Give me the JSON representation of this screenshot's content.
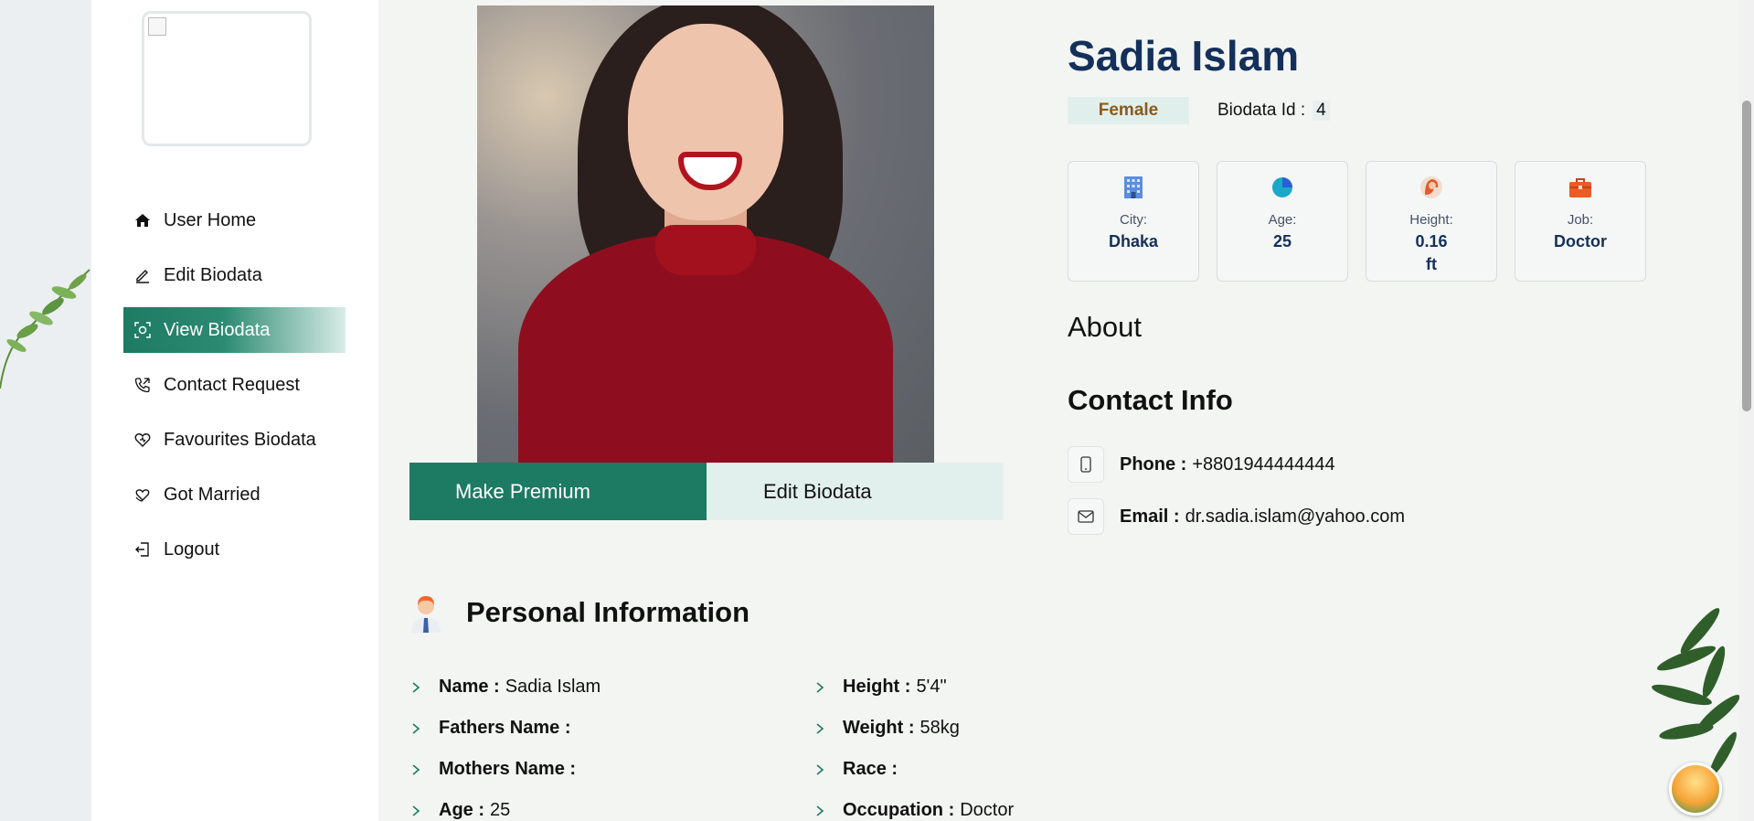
{
  "sidebar": {
    "items": [
      {
        "label": "User Home",
        "icon": "home-icon"
      },
      {
        "label": "Edit Biodata",
        "icon": "pencil-icon"
      },
      {
        "label": "View Biodata",
        "icon": "scan-icon"
      },
      {
        "label": "Contact Request",
        "icon": "phone-icon"
      },
      {
        "label": "Favourites Biodata",
        "icon": "heart-icon"
      },
      {
        "label": "Got Married",
        "icon": "heart-hands-icon"
      },
      {
        "label": "Logout",
        "icon": "logout-icon"
      }
    ],
    "active_index": 2
  },
  "actions": {
    "premium_label": "Make Premium",
    "edit_label": "Edit Biodata"
  },
  "profile": {
    "name": "Sadia Islam",
    "gender": "Female",
    "biodata_id_label": "Biodata Id :",
    "biodata_id": "4",
    "cards": [
      {
        "label": "City:",
        "value": "Dhaka",
        "icon": "city-icon"
      },
      {
        "label": "Age:",
        "value": "25",
        "icon": "pie-icon"
      },
      {
        "label": "Height:",
        "value": "0.16",
        "value2": "ft",
        "icon": "height-icon"
      },
      {
        "label": "Job:",
        "value": "Doctor",
        "icon": "briefcase-icon"
      }
    ]
  },
  "about": {
    "heading": "About"
  },
  "contact": {
    "heading": "Contact Info",
    "phone_label": "Phone :",
    "phone": "+8801944444444",
    "email_label": "Email :",
    "email": "dr.sadia.islam@yahoo.com"
  },
  "personal": {
    "heading": "Personal Information",
    "left": [
      {
        "label": "Name :",
        "value": "Sadia Islam"
      },
      {
        "label": "Fathers Name :",
        "value": ""
      },
      {
        "label": "Mothers Name :",
        "value": ""
      },
      {
        "label": "Age :",
        "value": "25"
      }
    ],
    "right": [
      {
        "label": "Height :",
        "value": "5'4\""
      },
      {
        "label": "Weight :",
        "value": "58kg"
      },
      {
        "label": "Race :",
        "value": ""
      },
      {
        "label": "Occupation :",
        "value": "Doctor"
      }
    ]
  },
  "colors": {
    "accent": "#1d7a63",
    "name": "#14305a",
    "gender_text": "#8a5a1d"
  }
}
